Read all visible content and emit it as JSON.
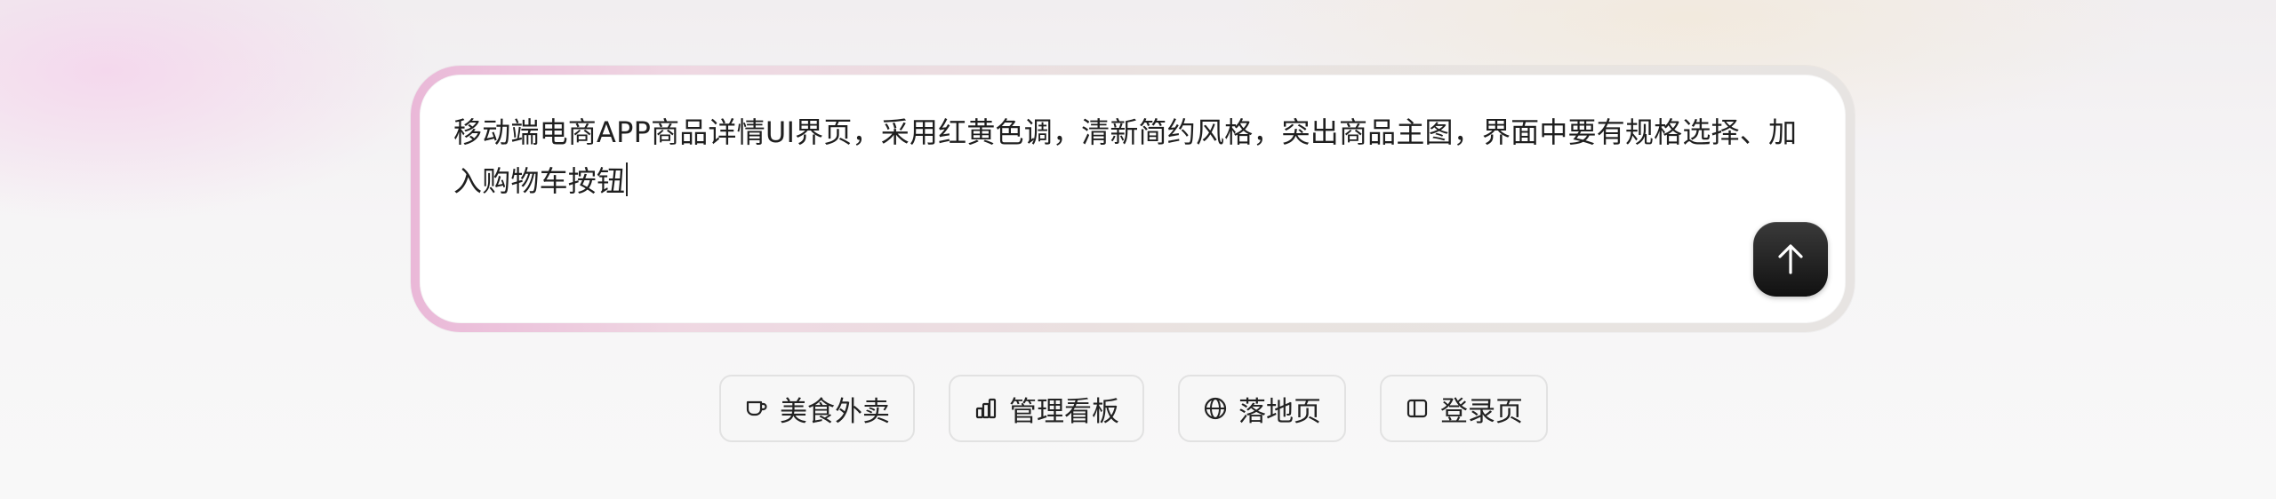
{
  "prompt": {
    "text": "移动端电商APP商品详情UI界页，采用红黄色调，清新简约风格，突出商品主图，界面中要有规格选择、加入购物车按钮"
  },
  "send_button": {
    "icon": "arrow-up-icon"
  },
  "suggestions": [
    {
      "label": "美食外卖",
      "icon": "cup-icon"
    },
    {
      "label": "管理看板",
      "icon": "bar-chart-icon"
    },
    {
      "label": "落地页",
      "icon": "globe-icon"
    },
    {
      "label": "登录页",
      "icon": "sidebar-panel-icon"
    }
  ],
  "colors": {
    "send_button_bg": "#111111",
    "frame_glow_pink": "#eab8d8",
    "chip_border": "#e2e2e2"
  }
}
